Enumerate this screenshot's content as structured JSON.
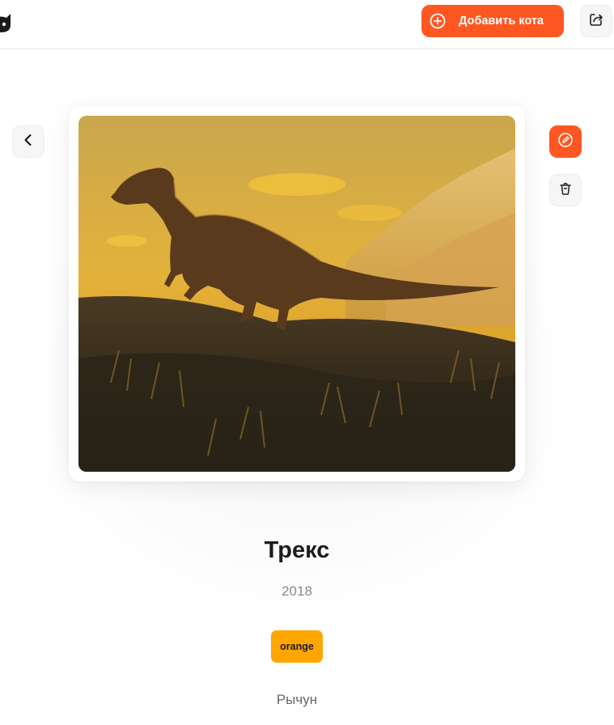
{
  "header": {
    "add_button_label": "Добавить кота",
    "logo_icon": "cat-logo-icon",
    "share_icon": "share-icon",
    "add_icon": "plus-circle-icon"
  },
  "actions": {
    "back_icon": "chevron-left-icon",
    "edit_icon": "edit-icon",
    "delete_icon": "trash-icon"
  },
  "cat": {
    "photo_icon": "dinosaur-photo",
    "name": "Трекс",
    "year": "2018",
    "color_tag": "orange",
    "description": "Рычун"
  },
  "colors": {
    "accent": "#ff5722",
    "tag": "#ffa500",
    "muted_text": "#8a8a8a"
  }
}
